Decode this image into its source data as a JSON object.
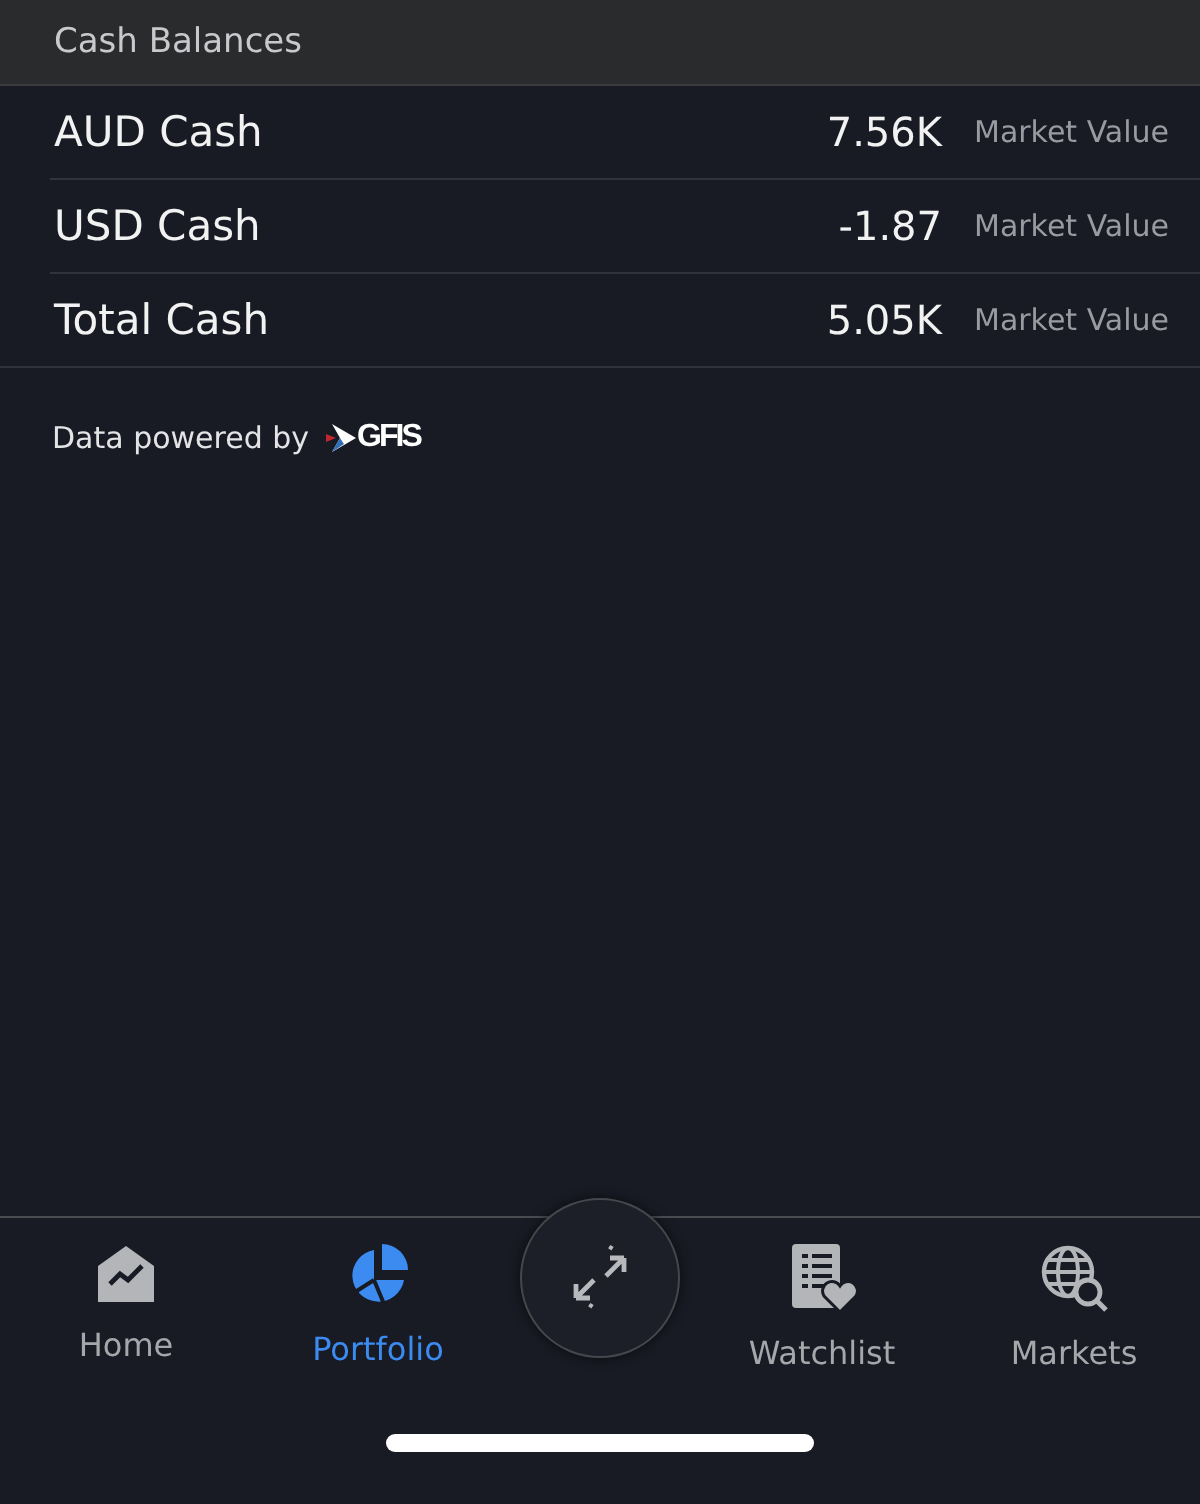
{
  "section": {
    "title": "Cash Balances"
  },
  "rows": [
    {
      "label": "AUD Cash",
      "value": "7.56K",
      "caption": "Market Value"
    },
    {
      "label": "USD Cash",
      "value": "-1.87",
      "caption": "Market Value"
    },
    {
      "label": "Total Cash",
      "value": "5.05K",
      "caption": "Market Value"
    }
  ],
  "attribution": {
    "text": "Data powered by",
    "logo": "GFIS"
  },
  "tabs": [
    {
      "kind": "home",
      "label": "Home",
      "selected": false
    },
    {
      "kind": "portfolio",
      "label": "Portfolio",
      "selected": true
    },
    {
      "kind": "center"
    },
    {
      "kind": "watchlist",
      "label": "Watchlist",
      "selected": false
    },
    {
      "kind": "markets",
      "label": "Markets",
      "selected": false
    }
  ]
}
